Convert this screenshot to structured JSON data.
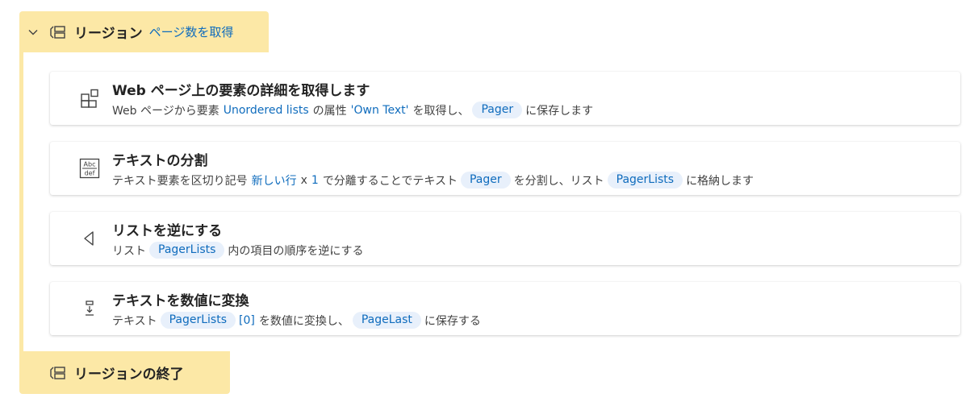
{
  "region": {
    "title": "リージョン",
    "name": "ページ数を取得",
    "end_title": "リージョンの終了"
  },
  "actions": [
    {
      "icon": "web-element-details-icon",
      "title": "Web ページ上の要素の詳細を取得します",
      "desc": {
        "t1": "Web ページから要素",
        "element": "Unordered lists",
        "t2": "の属性",
        "attribute": "'Own Text'",
        "t3": "を取得し、",
        "var": "Pager",
        "t4": "に保存します"
      }
    },
    {
      "icon": "split-text-icon",
      "icon_text_top": "Abc",
      "icon_text_bottom": "def",
      "title": "テキストの分割",
      "desc": {
        "t1": "テキスト要素を区切り記号",
        "delimiter": "新しい行",
        "t2": "x",
        "count": "1",
        "t3": "で分離することでテキスト",
        "var1": "Pager",
        "t4": "を分割し、リスト",
        "var2": "PagerLists",
        "t5": "に格納します"
      }
    },
    {
      "icon": "reverse-list-icon",
      "title": "リストを逆にする",
      "desc": {
        "t1": "リスト",
        "var": "PagerLists",
        "t2": "内の項目の順序を逆にする"
      }
    },
    {
      "icon": "text-to-number-icon",
      "title": "テキストを数値に変換",
      "desc": {
        "t1": "テキスト",
        "var1": "PagerLists",
        "index": "[0]",
        "t2": "を数値に変換し、",
        "var2": "PageLast",
        "t3": "に保存する"
      }
    }
  ],
  "colors": {
    "region_bg": "#fce8a6",
    "link": "#0f6cbd",
    "variable_bg": "#e8f0fb"
  }
}
